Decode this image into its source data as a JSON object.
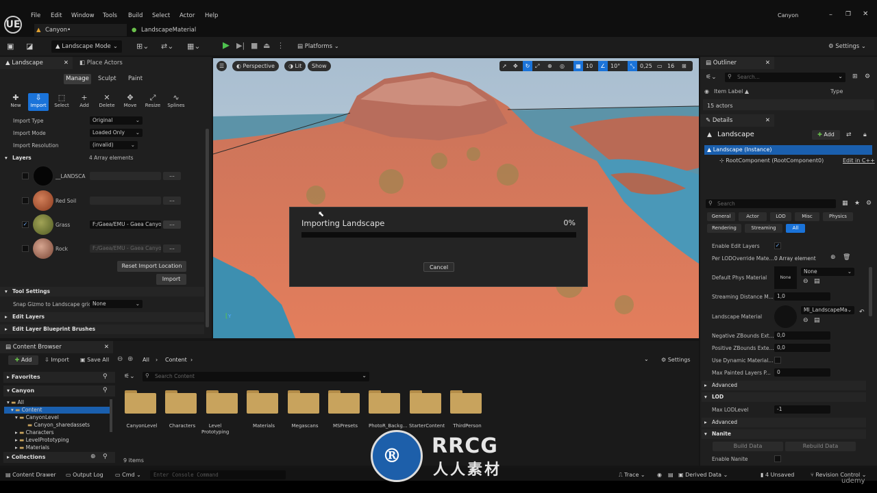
{
  "app": {
    "project": "Canyon",
    "logo": "UE"
  },
  "menu": [
    "File",
    "Edit",
    "Window",
    "Tools",
    "Build",
    "Select",
    "Actor",
    "Help"
  ],
  "doc_tabs": [
    {
      "label": "Canyon•",
      "icon": "level-icon"
    },
    {
      "label": "LandscapeMaterial",
      "icon": "material-icon"
    }
  ],
  "toolbar": {
    "mode": "Landscape Mode",
    "platforms": "Platforms",
    "settings": "Settings"
  },
  "left_panel": {
    "tabs": [
      "Landscape",
      "Place Actors"
    ],
    "mode_tabs": [
      "Manage",
      "Sculpt",
      "Paint"
    ],
    "tools": [
      "New",
      "Import",
      "Select",
      "Add",
      "Delete",
      "Move",
      "Resize",
      "Splines"
    ],
    "import_type": {
      "label": "Import Type",
      "value": "Original"
    },
    "import_mode": {
      "label": "Import Mode",
      "value": "Loaded Only"
    },
    "import_resolution": {
      "label": "Import Resolution",
      "value": "(invalid)"
    },
    "layers": {
      "label": "Layers",
      "count": "4 Array elements",
      "items": [
        {
          "name": "__LANDSCA",
          "path": "",
          "checked": false
        },
        {
          "name": "Red Soil",
          "path": "",
          "checked": false
        },
        {
          "name": "Grass",
          "path": "F:/Gaea/EMU - Gaea Canyo",
          "checked": true
        },
        {
          "name": "Rock",
          "path": "F:/Gaea/EMU - Gaea Canyo",
          "checked": false
        }
      ]
    },
    "reset_import": "Reset Import Location",
    "import_button": "Import",
    "tool_settings": "Tool Settings",
    "snap_label": "Snap Gizmo to Landscape grid",
    "snap_value": "None",
    "edit_layers": "Edit Layers",
    "edit_layer_brushes": "Edit Layer Blueprint Brushes"
  },
  "viewport": {
    "perspective": "Perspective",
    "lit": "Lit",
    "show": "Show",
    "grid": "10",
    "angle": "10°",
    "scale": "0,25",
    "camera_speed": "16"
  },
  "dialog": {
    "title": "Importing Landscape",
    "percent": "0%",
    "progress": 0,
    "cancel": "Cancel"
  },
  "content_browser": {
    "tab": "Content Browser",
    "add": "Add",
    "import": "Import",
    "save_all": "Save All",
    "path": [
      "All",
      "Content"
    ],
    "settings": "Settings",
    "favorites": "Favorites",
    "project": "Canyon",
    "search_placeholder": "Search Content",
    "tree": [
      "All",
      "Content",
      "CanyonLevel",
      "Canyon_sharedassets",
      "Characters",
      "LevelPrototyping",
      "Materials"
    ],
    "collections": "Collections",
    "folders": [
      "CanyonLevel",
      "Characters",
      "Level Prototyping",
      "Materials",
      "Megascans",
      "MSPresets",
      "PhotoR_Backg...",
      "StarterContent",
      "ThirdPerson"
    ],
    "item_count": "9 items"
  },
  "outliner": {
    "tab": "Outliner",
    "search": "Search...",
    "col_label": "Item Label ▲",
    "col_type": "Type",
    "count": "15 actors"
  },
  "details": {
    "tab": "Details",
    "title": "Landscape",
    "add": "Add",
    "instance": "Landscape (Instance)",
    "root": "RootComponent (RootComponent0)",
    "edit_cpp": "Edit in C++",
    "search": "Search",
    "cats_row1": [
      "General",
      "Actor",
      "LOD",
      "Misc",
      "Physics"
    ],
    "cats_row2": [
      "Rendering",
      "Streaming",
      "All"
    ],
    "props": {
      "enable_edit_layers": "Enable Edit Layers",
      "per_lod": "Per LODOverride Mate...",
      "per_lod_val": "0 Array element",
      "phys_mat": "Default Phys Material",
      "phys_none": "None",
      "phys_val": "None",
      "streaming": "Streaming Distance M...",
      "streaming_val": "1,0",
      "land_mat": "Landscape Material",
      "land_mat_val": "MI_LandscapeMa",
      "neg_z": "Negative ZBounds Ext...",
      "neg_z_val": "0,0",
      "pos_z": "Positive ZBounds Exte...",
      "pos_z_val": "0,0",
      "dyn_mat": "Use Dynamic Material...",
      "max_painted": "Max Painted Layers P...",
      "max_painted_val": "0",
      "advanced": "Advanced",
      "lod": "LOD",
      "max_lod": "Max LODLevel",
      "max_lod_val": "-1",
      "advanced2": "Advanced",
      "nanite": "Nanite",
      "build_data": "Build Data",
      "rebuild_data": "Rebuild Data",
      "enable_nanite": "Enable Nanite"
    }
  },
  "status": {
    "content_drawer": "Content Drawer",
    "output_log": "Output Log",
    "cmd": "Cmd",
    "console_placeholder": "Enter Console Command",
    "trace": "Trace",
    "derived": "Derived Data",
    "unsaved": "4 Unsaved",
    "revision": "Revision Control"
  },
  "watermark": {
    "brand": "RRCG",
    "sub": "人人素材",
    "udemy": "udemy"
  },
  "colors": {
    "accent": "#1a73d9",
    "panel": "#1f1f1f",
    "folder": "#c8a35d",
    "progress_track": "#0c0c0c"
  }
}
